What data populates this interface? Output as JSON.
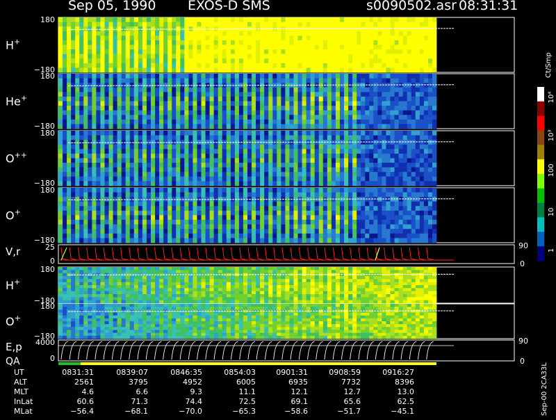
{
  "header": {
    "date": "Sep 05, 1990",
    "instrument": "EXOS-D SMS",
    "filename": "s0090502.asr",
    "time": "08:31:31"
  },
  "panels": [
    {
      "id": "h-plus",
      "species": "H",
      "charge": "+",
      "ymax": "180",
      "ymin": "−180"
    },
    {
      "id": "he-plus",
      "species": "He",
      "charge": "+",
      "ymax": "180",
      "ymin": "−180"
    },
    {
      "id": "o-plus-plus",
      "species": "O",
      "charge": "++",
      "ymax": "180",
      "ymin": "−180"
    },
    {
      "id": "o-plus",
      "species": "O",
      "charge": "+",
      "ymax": "180",
      "ymin": "−180"
    },
    {
      "id": "vr",
      "label": "V,r",
      "ymax": "25",
      "ymin": "0",
      "right_max": "90",
      "right_min": "0"
    },
    {
      "id": "h-plus-2",
      "species": "H",
      "charge": "+",
      "ymax": "180",
      "ymin": "−180"
    },
    {
      "id": "o-plus-2",
      "species": "O",
      "charge": "+",
      "ymax": "180",
      "ymin": "−180"
    },
    {
      "id": "ep",
      "label": "E,p",
      "ymax": "4000",
      "ymin": "0",
      "right_max": "90",
      "right_min": "0"
    }
  ],
  "qa_label": "QA",
  "colorbar": {
    "title": "Ct/Smp",
    "labels": [
      "10⁴",
      "10³",
      "100",
      "10",
      "1"
    ],
    "colors": [
      "#ffffff",
      "#8b0000",
      "#ff0000",
      "#8b4513",
      "#a08000",
      "#ffff00",
      "#7fff00",
      "#00c000",
      "#008040",
      "#00c0c0",
      "#0060c0",
      "#000080"
    ]
  },
  "side_text": "Sep-00 2CA33L",
  "footer": {
    "rows": [
      {
        "name": "UT",
        "values": [
          "0831:31",
          "0839:07",
          "0846:35",
          "0854:03",
          "0901:31",
          "0908:59",
          "0916:27"
        ]
      },
      {
        "name": "ALT",
        "values": [
          "2561",
          "3795",
          "4952",
          "6005",
          "6935",
          "7732",
          "8396"
        ]
      },
      {
        "name": "MLT",
        "values": [
          "4.6",
          "6.6",
          "9.3",
          "11.1",
          "12.1",
          "12.7",
          "13.0"
        ]
      },
      {
        "name": "InLat",
        "values": [
          "60.6",
          "71.3",
          "74.4",
          "72.5",
          "69.1",
          "65.6",
          "62.5"
        ]
      },
      {
        "name": "MLat",
        "values": [
          "−56.4",
          "−68.1",
          "−70.0",
          "−65.3",
          "−58.6",
          "−51.7",
          "−45.1"
        ]
      }
    ]
  },
  "chart_data": {
    "type": "heatmap",
    "title": "Sep 05, 1990   EXOS-D SMS",
    "x_ticks": [
      "0831:31",
      "0839:07",
      "0846:35",
      "0854:03",
      "0901:31",
      "0908:59",
      "0916:27"
    ],
    "panels": [
      "H+",
      "He+",
      "O++",
      "O+",
      "V,r",
      "H+",
      "O+",
      "E,p"
    ],
    "angle_range": [
      -180,
      180
    ],
    "velocity_range": [
      0,
      25
    ],
    "energy_range": [
      0,
      4000
    ],
    "colorbar_label": "Ct/Smp",
    "colorbar_scale": "log",
    "colorbar_range": [
      1,
      10000
    ]
  }
}
